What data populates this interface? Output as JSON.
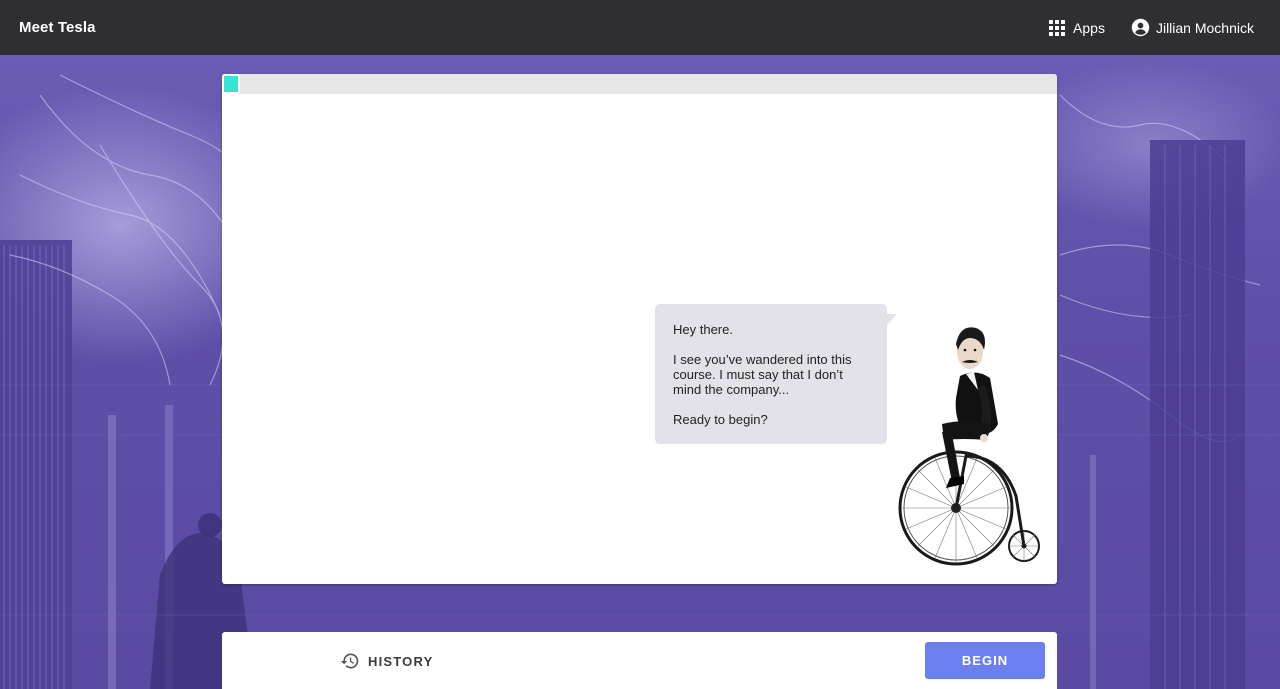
{
  "header": {
    "app_title": "Meet Tesla",
    "apps_label": "Apps",
    "apps_icon": "apps-grid-icon",
    "user_name": "Jillian Mochnick",
    "user_icon": "account-circle-icon"
  },
  "progress": {
    "fraction": 0.02
  },
  "dialog": {
    "line1": "Hey there.",
    "line2": "I see you’ve wandered into this course. I must say that I don’t mind the company...",
    "line3": "Ready to begin?"
  },
  "footer": {
    "history_label": "HISTORY",
    "history_icon": "history-icon",
    "begin_label": "BEGIN"
  },
  "colors": {
    "topbar": "#2f2e33",
    "background": "#5d4ea5",
    "progress_fill": "#37e4d3",
    "bubble": "#e4e2e9",
    "begin_button": "#6b7fee"
  }
}
